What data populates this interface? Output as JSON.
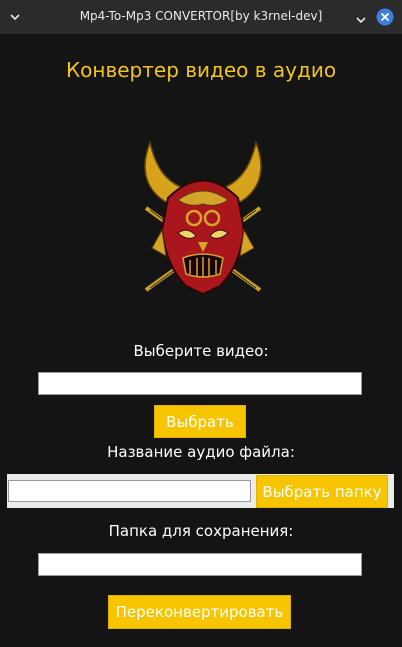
{
  "window": {
    "title": "Mp4-To-Mp3 CONVERTOR[by k3rnel-dev]"
  },
  "main": {
    "heading": "Конвертер видео в аудио",
    "video_label": "Выберите видео:",
    "video_value": "",
    "choose_button": "Выбрать",
    "audio_name_label": "Название аудио файла:",
    "audio_name_value": "",
    "choose_folder_button": "Выбрать папку",
    "save_folder_label": "Папка для сохранения:",
    "save_folder_value": "",
    "convert_button": "Переконвертировать"
  },
  "colors": {
    "background": "#141414",
    "accent_yellow": "#f7c500",
    "heading_yellow": "#f2c318",
    "close_blue": "#3d7ee0"
  },
  "icons": {
    "window_menu": "chevron-down-icon",
    "minimize": "minimize-icon",
    "close": "close-icon",
    "logo": "samurai-mask-logo"
  }
}
